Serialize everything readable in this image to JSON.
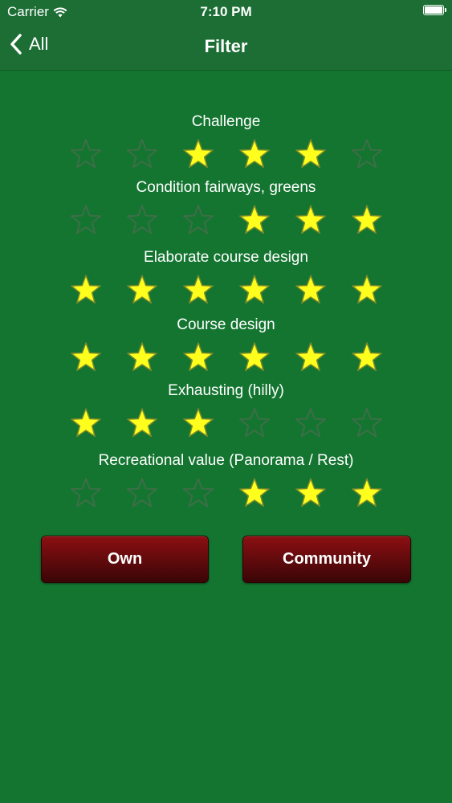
{
  "status_bar": {
    "carrier": "Carrier",
    "time": "7:10 PM"
  },
  "nav": {
    "back_label": "All",
    "title": "Filter"
  },
  "colors": {
    "background": "#137530",
    "star_filled": "#ffff1e",
    "star_empty_stroke": "#3e6e48",
    "button_red": "#6e0b0e"
  },
  "categories": [
    {
      "label": "Challenge",
      "rating": 3,
      "stars": [
        0,
        0,
        1,
        1,
        1,
        0
      ]
    },
    {
      "label": "Condition fairways, greens",
      "rating": 3,
      "stars": [
        0,
        0,
        0,
        1,
        1,
        1
      ]
    },
    {
      "label": "Elaborate course design",
      "rating": 6,
      "stars": [
        1,
        1,
        1,
        1,
        1,
        1
      ]
    },
    {
      "label": "Course design",
      "rating": 6,
      "stars": [
        1,
        1,
        1,
        1,
        1,
        1
      ]
    },
    {
      "label": "Exhausting (hilly)",
      "rating": 3,
      "stars": [
        1,
        1,
        1,
        0,
        0,
        0
      ]
    },
    {
      "label": "Recreational value (Panorama / Rest)",
      "rating": 3,
      "stars": [
        0,
        0,
        0,
        1,
        1,
        1
      ]
    }
  ],
  "buttons": {
    "own": "Own",
    "community": "Community"
  }
}
